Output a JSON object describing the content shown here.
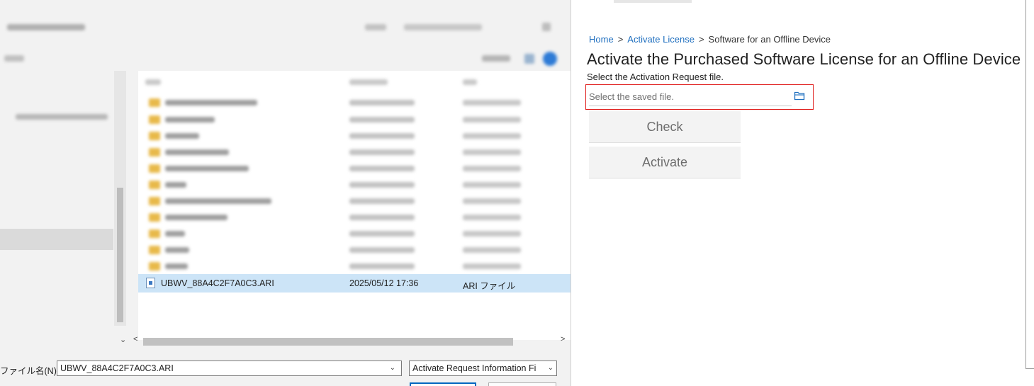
{
  "file_dialog": {
    "selected_file": {
      "name": "UBWV_88A4C2F7A0C3.ARI",
      "date": "2025/05/12 17:36",
      "type": "ARI ファイル"
    },
    "filename_label": "ファイル名(N):",
    "filename_value": "UBWV_88A4C2F7A0C3.ARI",
    "file_type_filter": "Activate Request Information Fi"
  },
  "web": {
    "breadcrumb": {
      "home": "Home",
      "sep1": ">",
      "activate": "Activate License",
      "sep2": ">",
      "current": "Software for an Offline Device"
    },
    "title": "Activate the Purchased Software License for an Offline Device",
    "instruction": "Select the Activation Request file.",
    "file_input_placeholder": "Select the saved file.",
    "buttons": {
      "check": "Check",
      "activate": "Activate"
    },
    "colors": {
      "link": "#1f6fbf",
      "highlight_border": "#e0201e",
      "button_bg": "#f3f3f3"
    }
  }
}
